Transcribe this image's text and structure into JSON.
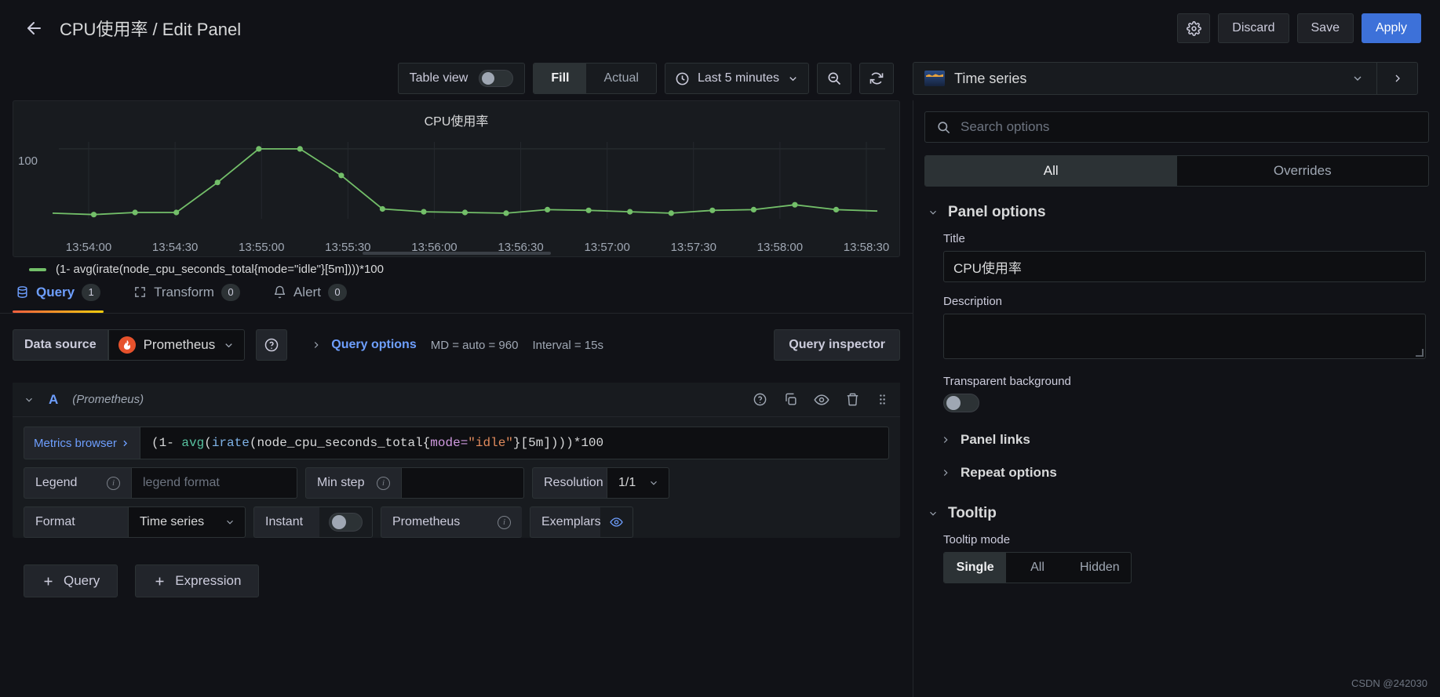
{
  "header": {
    "back_icon": "arrow-left-icon",
    "title": "CPU使用率 / Edit Panel",
    "settings_icon": "gear-icon",
    "discard_label": "Discard",
    "save_label": "Save",
    "apply_label": "Apply",
    "apply_color": "#3d71d9"
  },
  "toolbar": {
    "table_view_label": "Table view",
    "table_view_on": false,
    "fill_label": "Fill",
    "actual_label": "Actual",
    "fill_active": true,
    "time_range": "Last 5 minutes",
    "time_icon": "clock-icon",
    "zoom_out_icon": "zoom-out-icon",
    "refresh_icon": "refresh-icon"
  },
  "visualization": {
    "name": "Time series",
    "icon": "time-series-icon",
    "chevron_icon": "chevron-down-icon",
    "expand_icon": "chevron-right-icon"
  },
  "chart_data": {
    "type": "line",
    "title": "CPU使用率",
    "xlabel": "",
    "ylabel": "",
    "ylim": [
      0,
      110
    ],
    "yticks": [
      "100"
    ],
    "grid": true,
    "legend_position": "bottom",
    "line_color": "#73bf69",
    "xticks": [
      "13:54:00",
      "13:54:30",
      "13:55:00",
      "13:55:30",
      "13:56:00",
      "13:56:30",
      "13:57:00",
      "13:57:30",
      "13:58:00",
      "13:58:30"
    ],
    "series": [
      {
        "name": "(1- avg(irate(node_cpu_seconds_total{mode=\"idle\"}[5m])))*100",
        "x": [
          "13:53:45",
          "13:54:00",
          "13:54:15",
          "13:54:30",
          "13:54:45",
          "13:55:00",
          "13:55:15",
          "13:55:30",
          "13:55:45",
          "13:56:00",
          "13:56:15",
          "13:56:30",
          "13:56:45",
          "13:57:00",
          "13:57:15",
          "13:57:30",
          "13:57:45",
          "13:58:00",
          "13:58:15",
          "13:58:30",
          "13:58:45"
        ],
        "values": [
          8,
          6,
          9,
          9,
          52,
          100,
          100,
          62,
          14,
          10,
          9,
          8,
          13,
          12,
          10,
          8,
          12,
          13,
          20,
          13,
          11
        ]
      }
    ]
  },
  "tabs": [
    {
      "label": "Query",
      "badge": "1",
      "icon": "database-icon",
      "active": true
    },
    {
      "label": "Transform",
      "badge": "0",
      "icon": "transform-icon",
      "active": false
    },
    {
      "label": "Alert",
      "badge": "0",
      "icon": "bell-icon",
      "active": false
    }
  ],
  "datasource_row": {
    "label": "Data source",
    "value": "Prometheus",
    "logo": "prometheus-icon",
    "chevron_icon": "chevron-down-icon",
    "help_icon": "question-circle-icon",
    "query_options_label": "Query options",
    "query_options_chevron": "chevron-right-icon",
    "max_data_points": "MD = auto = 960",
    "interval": "Interval = 15s",
    "query_inspector_label": "Query inspector"
  },
  "query": {
    "ref_id": "A",
    "datasource_note": "(Prometheus)",
    "collapse_icon": "chevron-down-icon",
    "row_icons": [
      "help-icon",
      "duplicate-icon",
      "eye-icon",
      "trash-icon",
      "drag-icon"
    ],
    "metrics_browser_label": "Metrics browser",
    "metrics_browser_chevron": "chevron-right-icon",
    "expression": "(1- avg(irate(node_cpu_seconds_total{mode=\"idle\"}[5m])))*100",
    "expression_tokens": {
      "p1": "(1- ",
      "fn1": "avg",
      "p2": "(",
      "fn2": "irate",
      "p3": "(node_cpu_seconds_total{",
      "key": "mode=",
      "str": "\"idle\"",
      "p4": "}[5m])))*100"
    },
    "legend_label": "Legend",
    "legend_placeholder": "legend format",
    "legend_value": "",
    "min_step_label": "Min step",
    "min_step_value": "",
    "resolution_label": "Resolution",
    "resolution_value": "1/1",
    "format_label": "Format",
    "format_value": "Time series",
    "instant_label": "Instant",
    "instant_on": false,
    "prometheus_label": "Prometheus",
    "exemplars_label": "Exemplars",
    "exemplars_icon": "eye-icon"
  },
  "bottom_buttons": [
    {
      "label": "Query",
      "icon": "plus-icon"
    },
    {
      "label": "Expression",
      "icon": "plus-icon"
    }
  ],
  "options_pane": {
    "search_placeholder": "Search options",
    "search_icon": "search-icon",
    "tab_all": "All",
    "tab_overrides": "Overrides",
    "all_active": true,
    "panel_options": {
      "group_title": "Panel options",
      "title_label": "Title",
      "title_value": "CPU使用率",
      "description_label": "Description",
      "description_value": "",
      "transparent_label": "Transparent background",
      "transparent_on": false,
      "panel_links_label": "Panel links",
      "repeat_options_label": "Repeat options"
    },
    "tooltip": {
      "group_title": "Tooltip",
      "mode_label": "Tooltip mode",
      "modes": [
        "Single",
        "All",
        "Hidden"
      ],
      "mode_active": "Single"
    }
  },
  "watermark": "CSDN @242030"
}
